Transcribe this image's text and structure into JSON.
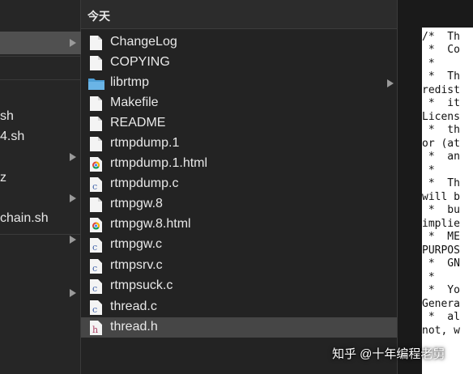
{
  "left_column": {
    "items": [
      "sh",
      "4.sh",
      "z",
      "chain.sh"
    ]
  },
  "middle_column": {
    "header": "今天",
    "files": [
      {
        "name": "ChangeLog",
        "icon": "document-icon"
      },
      {
        "name": "COPYING",
        "icon": "document-icon"
      },
      {
        "name": "librtmp",
        "icon": "folder-icon"
      },
      {
        "name": "Makefile",
        "icon": "document-icon"
      },
      {
        "name": "README",
        "icon": "document-icon"
      },
      {
        "name": "rtmpdump.1",
        "icon": "document-icon"
      },
      {
        "name": "rtmpdump.1.html",
        "icon": "chrome-html-icon"
      },
      {
        "name": "rtmpdump.c",
        "icon": "c-source-icon"
      },
      {
        "name": "rtmpgw.8",
        "icon": "document-icon"
      },
      {
        "name": "rtmpgw.8.html",
        "icon": "chrome-html-icon"
      },
      {
        "name": "rtmpgw.c",
        "icon": "c-source-icon"
      },
      {
        "name": "rtmpsrv.c",
        "icon": "c-source-icon"
      },
      {
        "name": "rtmpsuck.c",
        "icon": "c-source-icon"
      },
      {
        "name": "thread.c",
        "icon": "c-source-icon"
      },
      {
        "name": "thread.h",
        "icon": "h-header-icon"
      }
    ],
    "selected": "thread.h"
  },
  "preview": {
    "lines": [
      "/*  Th",
      " *  Co",
      " *",
      " *  Th",
      "redist",
      " *  it",
      "Licens",
      " *  th",
      "or (at",
      " *  an",
      " *",
      " *  Th",
      "will b",
      " *  bu",
      "implie",
      " *  ME",
      "PURPOS",
      " *  GN",
      " *",
      " *  Yo",
      "Genera",
      " *  al",
      "not, w"
    ]
  },
  "watermark": "知乎 @十年编程老舅",
  "colors": {
    "background": "#1e1e1e",
    "selection": "#464646",
    "folder": "#6ab4e6",
    "c_letter": "#3b5fa8",
    "h_letter": "#a83b5f"
  }
}
